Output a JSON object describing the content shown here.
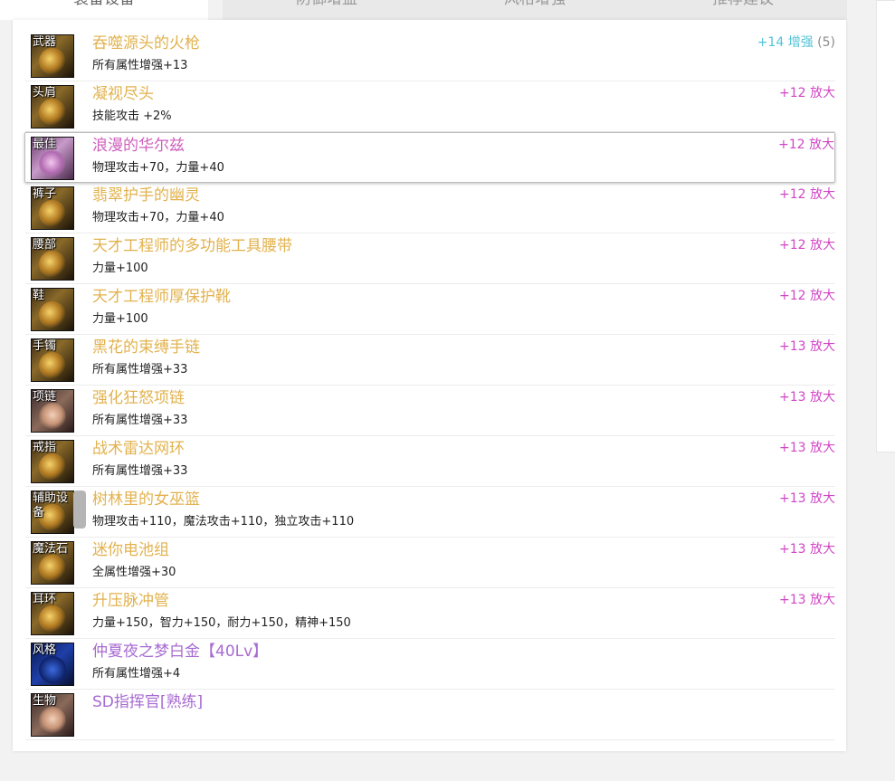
{
  "tabs": [
    {
      "label": "装备设备"
    },
    {
      "label": "防御增益"
    },
    {
      "label": "风格增强"
    },
    {
      "label": "推荐建议"
    }
  ],
  "colors": {
    "gold": "#e2b24e",
    "pink": "#cf5fbd",
    "purple": "#a76bd1",
    "cyan": "#53c3d6",
    "magenta": "#d046c6"
  },
  "items": [
    {
      "slot": "武器",
      "name": "吞噬源头的火枪",
      "stat": "所有属性增强+13",
      "enh": "+14 增强",
      "count": "(5)",
      "name_color": "gold",
      "enh_color": "cyan",
      "icon": "weapon-icon"
    },
    {
      "slot": "头肩",
      "name": "凝视尽头",
      "stat": "技能攻击 +2%",
      "enh": "+12 放大",
      "count": "",
      "name_color": "gold",
      "enh_color": "magenta",
      "icon": "shoulder-icon"
    },
    {
      "slot": "最佳",
      "name": "浪漫的华尔兹",
      "stat": "物理攻击+70，力量+40",
      "enh": "+12 放大",
      "count": "",
      "name_color": "pink",
      "enh_color": "magenta",
      "icon": "top-icon"
    },
    {
      "slot": "裤子",
      "name": "翡翠护手的幽灵",
      "stat": "物理攻击+70，力量+40",
      "enh": "+12 放大",
      "count": "",
      "name_color": "gold",
      "enh_color": "magenta",
      "icon": "pants-icon"
    },
    {
      "slot": "腰部",
      "name": "天才工程师的多功能工具腰带",
      "stat": "力量+100",
      "enh": "+12 放大",
      "count": "",
      "name_color": "gold",
      "enh_color": "magenta",
      "icon": "belt-icon"
    },
    {
      "slot": "鞋",
      "name": "天才工程师厚保护靴",
      "stat": "力量+100",
      "enh": "+12 放大",
      "count": "",
      "name_color": "gold",
      "enh_color": "magenta",
      "icon": "shoes-icon"
    },
    {
      "slot": "手镯",
      "name": "黑花的束缚手链",
      "stat": "所有属性增强+33",
      "enh": "+13 放大",
      "count": "",
      "name_color": "gold",
      "enh_color": "magenta",
      "icon": "bracelet-icon"
    },
    {
      "slot": "项链",
      "name": "强化狂怒项链",
      "stat": "所有属性增强+33",
      "enh": "+13 放大",
      "count": "",
      "name_color": "gold",
      "enh_color": "magenta",
      "icon": "necklace-icon"
    },
    {
      "slot": "戒指",
      "name": "战术雷达网环",
      "stat": "所有属性增强+33",
      "enh": "+13 放大",
      "count": "",
      "name_color": "gold",
      "enh_color": "magenta",
      "icon": "ring-icon"
    },
    {
      "slot": "辅助设备",
      "name": "树林里的女巫篮",
      "stat": "物理攻击+110，魔法攻击+110，独立攻击+110",
      "enh": "+13 放大",
      "count": "",
      "name_color": "gold",
      "enh_color": "magenta",
      "icon": "sub-equipment-icon"
    },
    {
      "slot": "魔法石",
      "name": "迷你电池组",
      "stat": "全属性增强+30",
      "enh": "+13 放大",
      "count": "",
      "name_color": "gold",
      "enh_color": "magenta",
      "icon": "magic-stone-icon"
    },
    {
      "slot": "耳环",
      "name": "升压脉冲管",
      "stat": "力量+150，智力+150，耐力+150，精神+150",
      "enh": "+13 放大",
      "count": "",
      "name_color": "gold",
      "enh_color": "magenta",
      "icon": "earring-icon"
    },
    {
      "slot": "风格",
      "name": "仲夏夜之梦白金【40Lv】",
      "stat": "所有属性增强+4",
      "enh": "",
      "count": "",
      "name_color": "purple",
      "enh_color": "magenta",
      "icon": "style-icon"
    },
    {
      "slot": "生物",
      "name": "SD指挥官[熟练]",
      "stat": "",
      "enh": "",
      "count": "",
      "name_color": "purple",
      "enh_color": "magenta",
      "icon": "creature-icon"
    }
  ]
}
